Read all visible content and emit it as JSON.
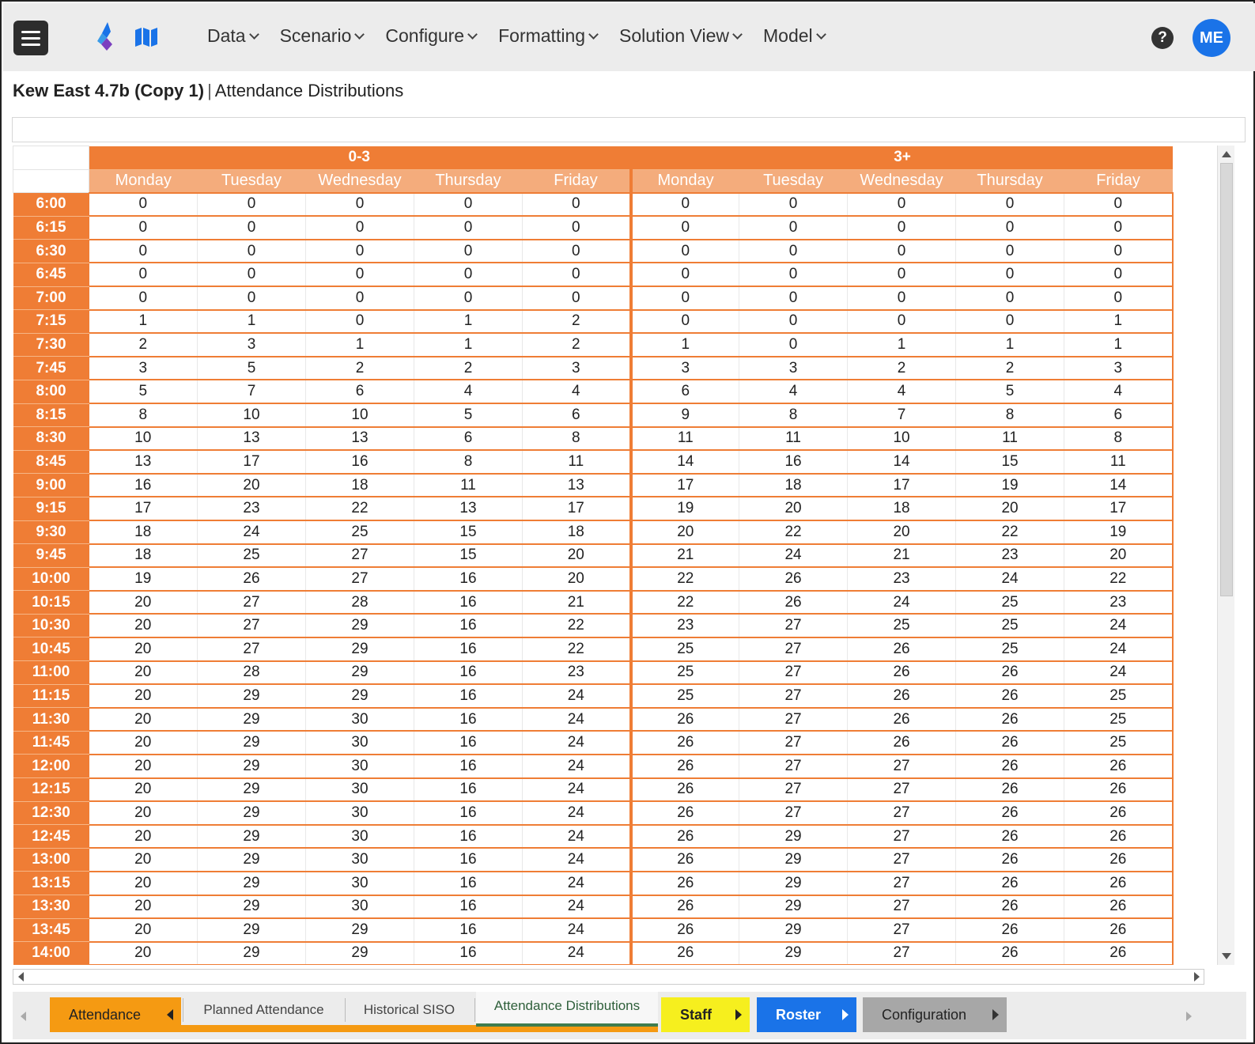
{
  "nav": {
    "menu": [
      {
        "label": "Data"
      },
      {
        "label": "Scenario"
      },
      {
        "label": "Configure"
      },
      {
        "label": "Formatting"
      },
      {
        "label": "Solution View"
      },
      {
        "label": "Model"
      }
    ],
    "help_label": "?",
    "avatar_initials": "ME",
    "colors": {
      "topbar": "#ececec",
      "avatar": "#1a73e8"
    }
  },
  "page": {
    "project": "Kew East 4.7b (Copy 1)",
    "separator": "|",
    "view": "Attendance Distributions"
  },
  "grid": {
    "groups": [
      "0-3",
      "3+"
    ],
    "days": [
      "Monday",
      "Tuesday",
      "Wednesday",
      "Thursday",
      "Friday"
    ],
    "accent": "#ef7d35",
    "rows": [
      {
        "time": "6:00",
        "values": [
          0,
          0,
          0,
          0,
          0,
          0,
          0,
          0,
          0,
          0
        ]
      },
      {
        "time": "6:15",
        "values": [
          0,
          0,
          0,
          0,
          0,
          0,
          0,
          0,
          0,
          0
        ]
      },
      {
        "time": "6:30",
        "values": [
          0,
          0,
          0,
          0,
          0,
          0,
          0,
          0,
          0,
          0
        ]
      },
      {
        "time": "6:45",
        "values": [
          0,
          0,
          0,
          0,
          0,
          0,
          0,
          0,
          0,
          0
        ]
      },
      {
        "time": "7:00",
        "values": [
          0,
          0,
          0,
          0,
          0,
          0,
          0,
          0,
          0,
          0
        ]
      },
      {
        "time": "7:15",
        "values": [
          1,
          1,
          0,
          1,
          2,
          0,
          0,
          0,
          0,
          1
        ]
      },
      {
        "time": "7:30",
        "values": [
          2,
          3,
          1,
          1,
          2,
          1,
          0,
          1,
          1,
          1
        ]
      },
      {
        "time": "7:45",
        "values": [
          3,
          5,
          2,
          2,
          3,
          3,
          3,
          2,
          2,
          3
        ]
      },
      {
        "time": "8:00",
        "values": [
          5,
          7,
          6,
          4,
          4,
          6,
          4,
          4,
          5,
          4
        ]
      },
      {
        "time": "8:15",
        "values": [
          8,
          10,
          10,
          5,
          6,
          9,
          8,
          7,
          8,
          6
        ]
      },
      {
        "time": "8:30",
        "values": [
          10,
          13,
          13,
          6,
          8,
          11,
          11,
          10,
          11,
          8
        ]
      },
      {
        "time": "8:45",
        "values": [
          13,
          17,
          16,
          8,
          11,
          14,
          16,
          14,
          15,
          11
        ]
      },
      {
        "time": "9:00",
        "values": [
          16,
          20,
          18,
          11,
          13,
          17,
          18,
          17,
          19,
          14
        ]
      },
      {
        "time": "9:15",
        "values": [
          17,
          23,
          22,
          13,
          17,
          19,
          20,
          18,
          20,
          17
        ]
      },
      {
        "time": "9:30",
        "values": [
          18,
          24,
          25,
          15,
          18,
          20,
          22,
          20,
          22,
          19
        ]
      },
      {
        "time": "9:45",
        "values": [
          18,
          25,
          27,
          15,
          20,
          21,
          24,
          21,
          23,
          20
        ]
      },
      {
        "time": "10:00",
        "values": [
          19,
          26,
          27,
          16,
          20,
          22,
          26,
          23,
          24,
          22
        ]
      },
      {
        "time": "10:15",
        "values": [
          20,
          27,
          28,
          16,
          21,
          22,
          26,
          24,
          25,
          23
        ]
      },
      {
        "time": "10:30",
        "values": [
          20,
          27,
          29,
          16,
          22,
          23,
          27,
          25,
          25,
          24
        ]
      },
      {
        "time": "10:45",
        "values": [
          20,
          27,
          29,
          16,
          22,
          25,
          27,
          26,
          25,
          24
        ]
      },
      {
        "time": "11:00",
        "values": [
          20,
          28,
          29,
          16,
          23,
          25,
          27,
          26,
          26,
          24
        ]
      },
      {
        "time": "11:15",
        "values": [
          20,
          29,
          29,
          16,
          24,
          25,
          27,
          26,
          26,
          25
        ]
      },
      {
        "time": "11:30",
        "values": [
          20,
          29,
          30,
          16,
          24,
          26,
          27,
          26,
          26,
          25
        ]
      },
      {
        "time": "11:45",
        "values": [
          20,
          29,
          30,
          16,
          24,
          26,
          27,
          26,
          26,
          25
        ]
      },
      {
        "time": "12:00",
        "values": [
          20,
          29,
          30,
          16,
          24,
          26,
          27,
          27,
          26,
          26
        ]
      },
      {
        "time": "12:15",
        "values": [
          20,
          29,
          30,
          16,
          24,
          26,
          27,
          27,
          26,
          26
        ]
      },
      {
        "time": "12:30",
        "values": [
          20,
          29,
          30,
          16,
          24,
          26,
          27,
          27,
          26,
          26
        ]
      },
      {
        "time": "12:45",
        "values": [
          20,
          29,
          30,
          16,
          24,
          26,
          29,
          27,
          26,
          26
        ]
      },
      {
        "time": "13:00",
        "values": [
          20,
          29,
          30,
          16,
          24,
          26,
          29,
          27,
          26,
          26
        ]
      },
      {
        "time": "13:15",
        "values": [
          20,
          29,
          30,
          16,
          24,
          26,
          29,
          27,
          26,
          26
        ]
      },
      {
        "time": "13:30",
        "values": [
          20,
          29,
          30,
          16,
          24,
          26,
          29,
          27,
          26,
          26
        ]
      },
      {
        "time": "13:45",
        "values": [
          20,
          29,
          29,
          16,
          24,
          26,
          29,
          27,
          26,
          26
        ]
      },
      {
        "time": "14:00",
        "values": [
          20,
          29,
          29,
          16,
          24,
          26,
          29,
          27,
          26,
          26
        ]
      }
    ]
  },
  "tabs": {
    "attendance": "Attendance",
    "planned_attendance": "Planned Attendance",
    "historical_siso": "Historical SISO",
    "attendance_distributions": "Attendance Distributions",
    "staff": "Staff",
    "roster": "Roster",
    "configuration": "Configuration",
    "colors": {
      "attendance": "#f59a12",
      "staff": "#f6ef1e",
      "roster": "#1a73e8",
      "configuration": "#a7a7a7"
    }
  }
}
